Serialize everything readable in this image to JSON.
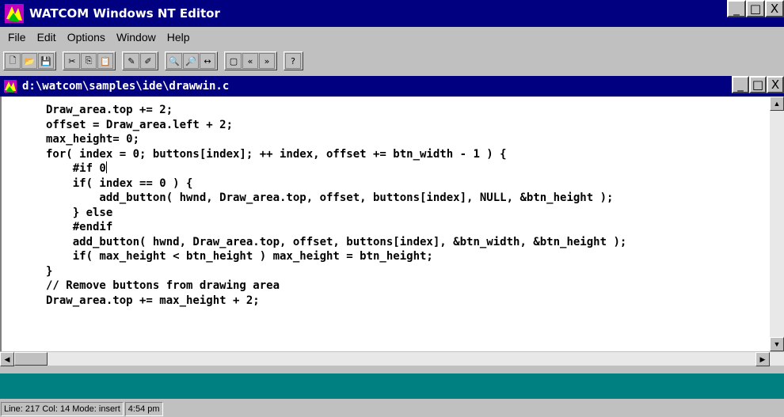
{
  "app": {
    "title": "WATCOM Windows NT Editor",
    "title_icon": "watcom-editor-icon"
  },
  "window_buttons": {
    "minimize": "_",
    "maximize": "□",
    "close": "X"
  },
  "menu": [
    {
      "label": "File"
    },
    {
      "label": "Edit"
    },
    {
      "label": "Options"
    },
    {
      "label": "Window"
    },
    {
      "label": "Help"
    }
  ],
  "toolbar": {
    "groups": [
      [
        "new-file-icon",
        "open-folder-icon",
        "save-icon"
      ],
      [
        "cut-icon",
        "copy-icon",
        "paste-icon"
      ],
      [
        "pencil-icon",
        "pencil-alt-icon"
      ],
      [
        "find-icon",
        "find-next-icon",
        "match-brace-icon"
      ],
      [
        "window-icon",
        "prev-icon",
        "next-icon"
      ],
      [
        "help-icon"
      ]
    ],
    "glyphs": {
      "new-file-icon": "🗋",
      "open-folder-icon": "📂",
      "save-icon": "💾",
      "cut-icon": "✂",
      "copy-icon": "⎘",
      "paste-icon": "📋",
      "pencil-icon": "✎",
      "pencil-alt-icon": "✐",
      "find-icon": "🔍",
      "find-next-icon": "🔎",
      "match-brace-icon": "↔",
      "window-icon": "▢",
      "prev-icon": "«",
      "next-icon": "»",
      "help-icon": "?"
    }
  },
  "document": {
    "title": "d:\\watcom\\samples\\ide\\drawwin.c",
    "lines": [
      "Draw_area.top += 2;",
      "offset = Draw_area.left + 2;",
      "max_height= 0;",
      "for( index = 0; buttons[index]; ++ index, offset += btn_width - 1 ) {",
      "    #if 0",
      "    if( index == 0 ) {",
      "        add_button( hwnd, Draw_area.top, offset, buttons[index], NULL, &btn_height );",
      "    } else",
      "    #endif",
      "    add_button( hwnd, Draw_area.top, offset, buttons[index], &btn_width, &btn_height );",
      "    if( max_height < btn_height ) max_height = btn_height;",
      "}",
      "// Remove buttons from drawing area",
      "Draw_area.top += max_height + 2;"
    ],
    "caret_line": 4
  },
  "colors": {
    "titlebar": "#000080",
    "mdi_background": "#008080",
    "chrome": "#c0c0c0"
  },
  "statusbar": {
    "line": "Line: 217",
    "col": "Col: 14",
    "mode": "Mode: insert",
    "time": "4:54 pm"
  }
}
